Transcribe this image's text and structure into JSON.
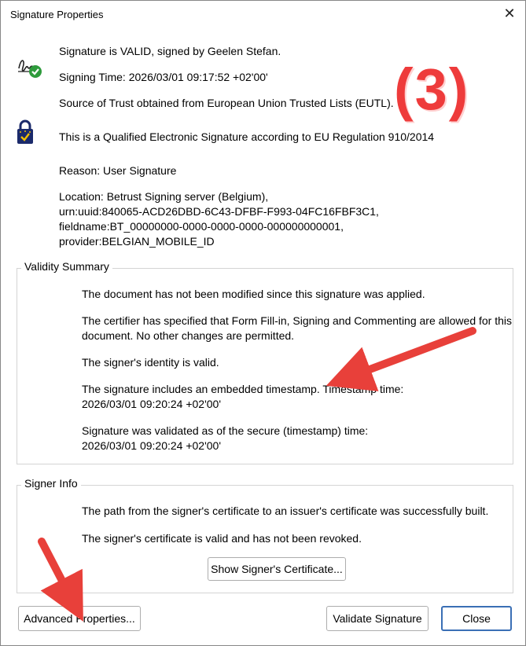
{
  "window": {
    "title": "Signature Properties"
  },
  "icons": {
    "close": "close-icon",
    "signature_valid": "signature-valid-icon",
    "qualified_lock": "lock-icon"
  },
  "header": {
    "status": "Signature is VALID, signed by Geelen Stefan.",
    "signing_time": "Signing Time:  2026/03/01 09:17:52 +02'00'",
    "trust_source": "Source of Trust obtained from European Union Trusted Lists (EUTL).",
    "qualified": "This is a Qualified Electronic Signature according to EU Regulation 910/2014",
    "reason": "Reason:  User Signature",
    "location_lines": [
      "Location:  Betrust Signing server (Belgium),",
      "urn:uuid:840065-ACD26DBD-6C43-DFBF-F993-04FC16FBF3C1,",
      "fieldname:BT_00000000-0000-0000-0000-000000000001,",
      "provider:BELGIAN_MOBILE_ID"
    ]
  },
  "validity_summary": {
    "title": "Validity Summary",
    "not_modified": "The document has not been modified since this signature was applied.",
    "certifier_lines": [
      "The certifier has specified that Form Fill-in, Signing and Commenting are allowed for this",
      "document. No other changes are permitted."
    ],
    "identity": "The signer's identity is valid.",
    "timestamp_lines": [
      "The signature includes an embedded timestamp. Timestamp time:",
      "2026/03/01 09:20:24 +02'00'"
    ],
    "validated_lines": [
      "Signature was validated as of the secure (timestamp) time:",
      "2026/03/01 09:20:24 +02'00'"
    ]
  },
  "signer_info": {
    "title": "Signer Info",
    "path": "The path from the signer's certificate to an issuer's certificate was successfully built.",
    "cert_valid": "The signer's certificate is valid and has not been revoked.",
    "show_cert_button": "Show Signer's Certificate..."
  },
  "buttons": {
    "advanced": "Advanced Properties...",
    "validate": "Validate Signature",
    "close": "Close"
  },
  "annotation": {
    "step_label": "(3)",
    "arrow_color": "#e8403a"
  }
}
